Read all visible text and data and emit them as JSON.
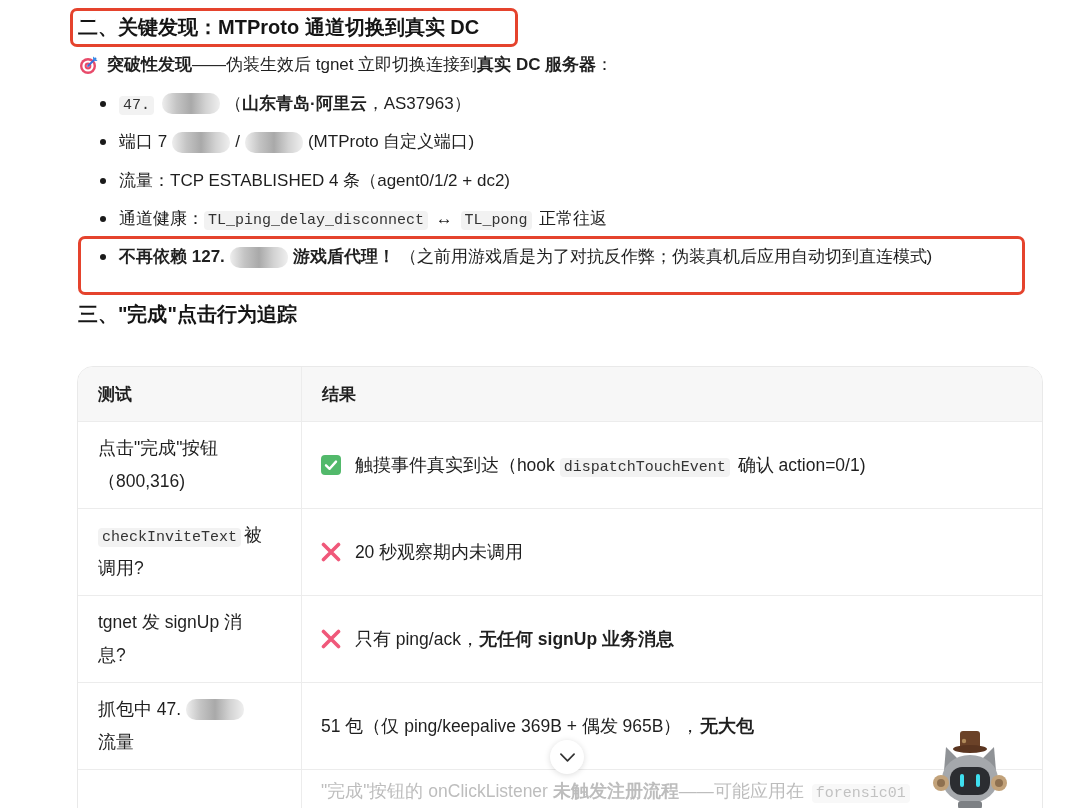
{
  "findings": {
    "heading": "二、关键发现：MTProto 通道切换到真实 DC",
    "annotated": true,
    "lead": "**突破性发现**——伪装生效后 tgnet 立即切换连接到**真实 DC 服务器**：",
    "items": [
      {
        "annotated": false,
        "segments": [
          {
            "kind": "code",
            "text": "47."
          },
          {
            "kind": "redacted"
          },
          {
            "kind": "text",
            "text": "（**山东青岛·阿里云**，AS37963）"
          }
        ]
      },
      {
        "annotated": false,
        "segments": [
          {
            "kind": "text",
            "text": "端口 7"
          },
          {
            "kind": "redacted"
          },
          {
            "kind": "text",
            "text": "/"
          },
          {
            "kind": "redacted"
          },
          {
            "kind": "text",
            "text": "(MTProto 自定义端口)"
          }
        ]
      },
      {
        "annotated": false,
        "segments": [
          {
            "kind": "text",
            "text": "流量：TCP ESTABLISHED 4 条（agent0/1/2 + dc2)"
          }
        ]
      },
      {
        "annotated": false,
        "segments": [
          {
            "kind": "text",
            "text": "通道健康："
          },
          {
            "kind": "code",
            "text": "TL_ping_delay_disconnect"
          },
          {
            "kind": "text",
            "text": " ↔ "
          },
          {
            "kind": "code",
            "text": "TL_pong"
          },
          {
            "kind": "text",
            "text": " 正常往返"
          }
        ]
      },
      {
        "annotated": true,
        "segments": [
          {
            "kind": "bold",
            "text": "不再依赖 127."
          },
          {
            "kind": "redacted"
          },
          {
            "kind": "bold",
            "text": "游戏盾代理！"
          },
          {
            "kind": "text",
            "text": " （之前用游戏盾是为了对抗反作弊；伪装真机后应用自动切到直连模式)"
          }
        ]
      }
    ]
  },
  "tracking": {
    "heading": "三、\"完成\"点击行为追踪",
    "annotated": false,
    "table": {
      "columns": [
        "测试",
        "结果"
      ],
      "rows": [
        {
          "kind": "pass",
          "faded": false,
          "test": [
            {
              "kind": "text",
              "text": "点击\"完成\"按钮（800,316)"
            }
          ],
          "result": [
            {
              "kind": "text",
              "text": "触摸事件真实到达（hook "
            },
            {
              "kind": "code",
              "text": "dispatchTouchEvent"
            },
            {
              "kind": "text",
              "text": " 确认 action=0/1)"
            }
          ]
        },
        {
          "kind": "fail",
          "faded": false,
          "test": [
            {
              "kind": "code",
              "text": "checkInviteText"
            },
            {
              "kind": "text",
              "text": "被调用?"
            }
          ],
          "result": [
            {
              "kind": "text",
              "text": "20 秒观察期内未调用"
            }
          ]
        },
        {
          "kind": "fail",
          "faded": false,
          "test": [
            {
              "kind": "text",
              "text": "tgnet 发 signUp 消息?"
            }
          ],
          "result": [
            {
              "kind": "text",
              "text": "只有 ping/ack，**无任何 signUp 业务消息**"
            }
          ]
        },
        {
          "kind": "plain",
          "faded": false,
          "test": [
            {
              "kind": "text",
              "text": "抓包中 47."
            },
            {
              "kind": "redacted"
            },
            {
              "kind": "text",
              "text": "流量"
            }
          ],
          "result": [
            {
              "kind": "text",
              "text": "51 包（仅 ping/keepalive 369B + 偶发 965B），**无大包**"
            }
          ]
        },
        {
          "kind": "plain",
          "faded": true,
          "result": [
            {
              "kind": "text",
              "text": "\"完成\"按钮的 onClickListener **未触发注册流程**——可能应用在 "
            },
            {
              "kind": "code",
              "text": "forensic01"
            }
          ]
        }
      ]
    }
  }
}
